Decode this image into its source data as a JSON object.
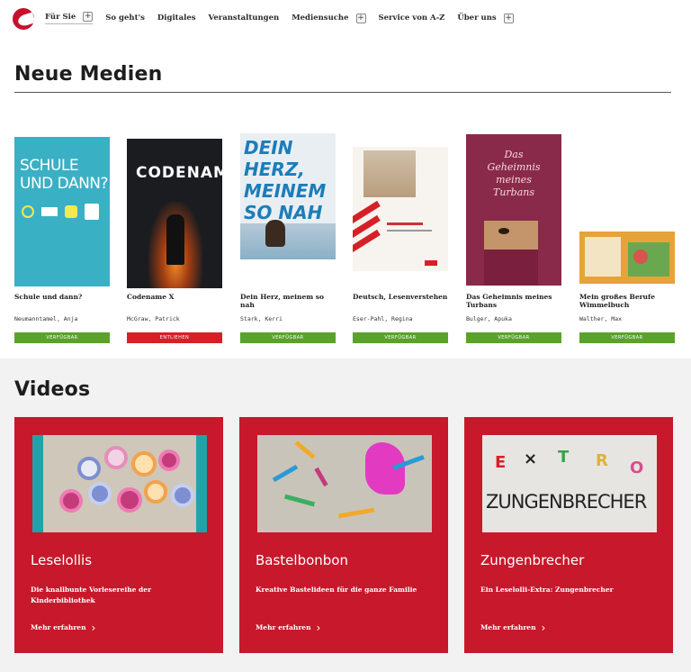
{
  "nav": {
    "items": [
      {
        "label": "Für Sie",
        "has_plus": true,
        "active": true
      },
      {
        "label": "So geht's",
        "has_plus": false
      },
      {
        "label": "Digitales",
        "has_plus": false
      },
      {
        "label": "Veranstaltungen",
        "has_plus": false
      },
      {
        "label": "Mediensuche",
        "has_plus": true
      },
      {
        "label": "Service von A-Z",
        "has_plus": false
      },
      {
        "label": "Über uns",
        "has_plus": true
      }
    ],
    "plus_symbol": "+"
  },
  "neue_medien": {
    "title": "Neue Medien",
    "books": [
      {
        "title": "Schule und dann?",
        "author": "Neumanntamel, Anja",
        "status": "VERFÜGBAR",
        "available": true,
        "cover_text": "SCHULE UND DANN?"
      },
      {
        "title": "Codename X",
        "author": "McGraw, Patrick",
        "status": "ENTLIEHEN",
        "available": false,
        "cover_text": "CODENAME"
      },
      {
        "title": "Dein Herz, meinem so nah",
        "author": "Stark, Kerri",
        "status": "VERFÜGBAR",
        "available": true,
        "cover_text": "DEIN HERZ, MEINEM SO NAH"
      },
      {
        "title": "Deutsch, Lesenverstehen",
        "author": "Eser-Pahl, Regina",
        "status": "VERFÜGBAR",
        "available": true,
        "cover_text": ""
      },
      {
        "title": "Das Geheimnis meines Turbans",
        "author": "Bulger, Apuka",
        "status": "VERFÜGBAR",
        "available": true,
        "cover_text": "Das Geheimnis meines Turbans"
      },
      {
        "title": "Mein großes Berufe Wimmelbuch",
        "author": "Walther, Max",
        "status": "VERFÜGBAR",
        "available": true,
        "cover_text": ""
      }
    ]
  },
  "videos": {
    "title": "Videos",
    "items": [
      {
        "title": "Leselollis",
        "description": "Die knallbunte Vorlesereihe der Kinderbibliothek",
        "more": "Mehr erfahren"
      },
      {
        "title": "Bastelbonbon",
        "description": "Kreative Bastelideen für die ganze Familie",
        "more": "Mehr erfahren"
      },
      {
        "title": "Zungenbrecher",
        "description": "Ein Leselolli-Extra: Zungenbrecher",
        "more": "Mehr erfahren",
        "thumb_text": "ZUNGENBRECHER"
      }
    ]
  },
  "colors": {
    "brand_red": "#c8182b",
    "available_green": "#5ba22b",
    "lent_red": "#d62027"
  }
}
